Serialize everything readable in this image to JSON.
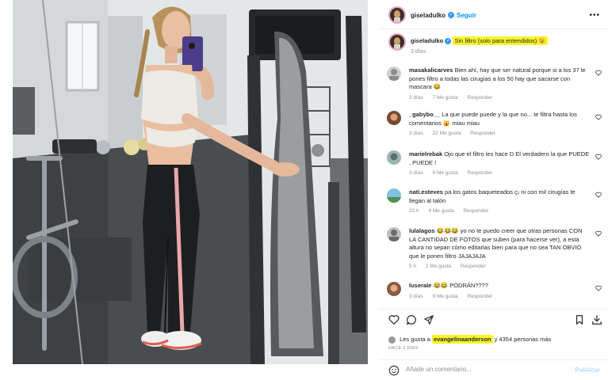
{
  "post": {
    "username": "giseladulko",
    "follow_label": "Seguir",
    "verified": true
  },
  "caption": {
    "username": "giseladulko",
    "text": "Sin filtro (solo para entendidos) 😉",
    "time": "3 días"
  },
  "comments": [
    {
      "user": "masakalicarves",
      "text": "Bien ahí, hay que ser natural porque si a los 37 le pones filtro a todas las cirugías a los 50 hay que sacarse con mascara 😂",
      "time": "3 días",
      "likes": "7 Me gusta",
      "reply": "Responder"
    },
    {
      "user": "_gabybo__",
      "text": "La que puede puede y la que no... te filtra hasta los comentarios 🙀 miau miau",
      "time": "3 días",
      "likes": "22 Me gusta",
      "reply": "Responder"
    },
    {
      "user": "marielrebak",
      "text": "Ojo que el filtro les hace D El verdadero la que PUEDE , PUEDE !",
      "time": "3 días",
      "likes": "9 Me gusta",
      "reply": "Responder"
    },
    {
      "user": "nati.esteves",
      "text": "pa los gatos baqueteados ç¡ ni con mil cirugías te llegan al talón",
      "time": "22 h",
      "likes": "4 Me gusta",
      "reply": "Responder"
    },
    {
      "user": "lulalagos",
      "text": "😂😂😂 yo no te puedo creer que otras personas CON LA CANTIDAD DE FOTOS que suben (para hacerse ver), a esta altura no sepan cómo editarlas bien para que no sea TAN OBVIO que le ponen filtro JAJAJAJA",
      "time": "5 h",
      "likes": "2 Me gusta",
      "reply": "Responder"
    },
    {
      "user": "luserale",
      "text": "😂😂 PODRÁN????",
      "time": "3 días",
      "likes": "9 Me gusta",
      "reply": "Responder"
    }
  ],
  "likes_line": {
    "prefix": "Les gusta a",
    "user": "evangelinaanderson",
    "suffix": "y 4354 personas más"
  },
  "date_small": "HACE 3 DÍAS",
  "add_comment": {
    "placeholder": "Añade un comentario...",
    "publish_label": "Publicar"
  },
  "icons": [
    "more-icon",
    "verified-icon",
    "heart-icon",
    "comment-icon",
    "share-icon",
    "bookmark-icon",
    "download-icon",
    "emoji-icon"
  ],
  "colors": {
    "link_blue": "#0095f6",
    "verified_blue": "#3797f0",
    "highlight_yellow": "#f7f52a",
    "muted_text": "#8e8e8e"
  }
}
